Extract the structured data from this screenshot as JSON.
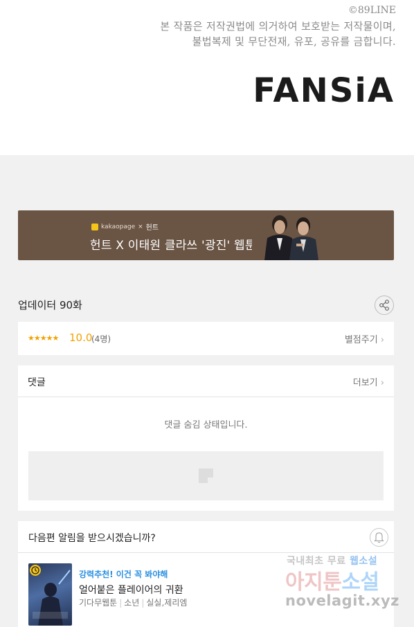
{
  "copyright": "©89LINE",
  "notice": {
    "line1": "본 작품은 저작권법에 의거하여 보호받는 저작물이며,",
    "line2": "불법복제 및 무단전재, 유포, 공유를 금합니다."
  },
  "logo": "FANSiA",
  "banner": {
    "brand": "kakaopage",
    "brand_sep": "×",
    "partner": "헌트",
    "title": "헌트 X 이태원 클라쓰 '광진' 웹툰"
  },
  "update": {
    "title": "업데이터 90화"
  },
  "rating": {
    "stars": "★★★★★",
    "score": "10.0",
    "count": "(4명)",
    "rate_label": "별점주기",
    "rate_chevron": "›"
  },
  "comments": {
    "title": "댓글",
    "more_label": "더보기",
    "more_chevron": "›",
    "hidden_message": "댓글 숨김 상태입니다."
  },
  "notify": {
    "question": "다음편 알림을 받으시겠습니까?"
  },
  "recommendation": {
    "tag": "강력추천! 이건 꼭 봐야해",
    "title": "얼어붙은 플레이어의 귀환",
    "author": "기다무웹툰",
    "genre": "소년",
    "tags": "실실,제리엠"
  },
  "watermark": {
    "line1_a": "국내최초 무료",
    "line1_b": "웹소설",
    "line2_a": "아지툰",
    "line2_b": "소설",
    "line3": "novelagit.xyz"
  },
  "colors": {
    "star": "#f2a100",
    "banner_bg": "#6a5444",
    "link_blue": "#2a8fe0",
    "page_bg": "#f1f1f1"
  }
}
